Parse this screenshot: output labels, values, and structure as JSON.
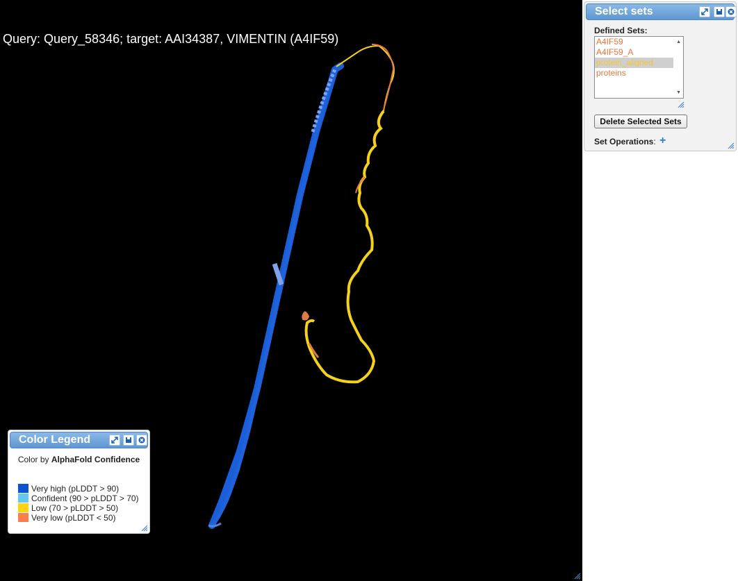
{
  "viewer": {
    "title": "Query: Query_58346; target: AAI34387, VIMENTIN (A4IF59)"
  },
  "select_sets": {
    "title": "Select sets",
    "defined_label": "Defined Sets:",
    "sets": [
      {
        "label": "A4IF59",
        "color": "#e8743c",
        "selected": false
      },
      {
        "label": "A4IF59_A",
        "color": "#e8743c",
        "selected": false
      },
      {
        "label": "protein_aligned",
        "color": "#f5c531",
        "selected": true
      },
      {
        "label": "proteins",
        "color": "#e8743c",
        "selected": false
      }
    ],
    "delete_label": "Delete Selected Sets",
    "operations_label": "Set Operations",
    "operations_colon": ":",
    "add_symbol": "+"
  },
  "legend": {
    "title": "Color Legend",
    "subtitle_prefix": "Color by ",
    "subtitle_bold": "AlphaFold Confidence",
    "items": [
      {
        "label": "Very high (pLDDT > 90)",
        "color": "#0b53d4"
      },
      {
        "label": "Confident (90 > pLDDT > 70)",
        "color": "#64c8f0"
      },
      {
        "label": "Low (70 > pLDDT > 50)",
        "color": "#fdd40f"
      },
      {
        "label": "Very low (pLDDT < 50)",
        "color": "#fd7d4d"
      }
    ]
  },
  "colors": {
    "header_blue": "#5f97d2",
    "helix_blue": "#1a5fd8",
    "helix_light_blue": "#7fa3e8",
    "coil_yellow": "#f5d21a",
    "coil_orange": "#e27a44"
  },
  "icons": [
    "expand-icon",
    "save-icon",
    "close-icon",
    "resize-grip-icon"
  ]
}
